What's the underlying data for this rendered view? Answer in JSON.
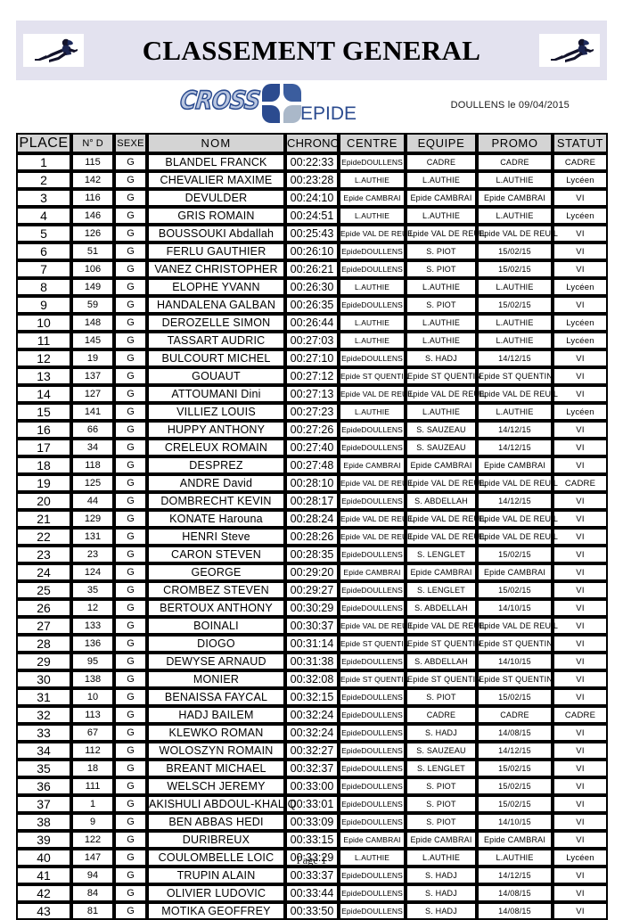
{
  "header": {
    "title": "CLASSEMENT GENERAL",
    "banner_color": "#e3e2ef",
    "runner_icon_left": "runner-icon",
    "runner_icon_right": "runner-icon"
  },
  "logo": {
    "cross_text": "CROSS",
    "epide_text": "EPIDE",
    "mark_icon": "epide-petals-icon",
    "accent_color": "#2b4b8f"
  },
  "event": {
    "location_date": "DOULLENS le 09/04/2015"
  },
  "table": {
    "columns": [
      "PLACE",
      "N° D",
      "SEXE",
      "NOM",
      "CHRONO",
      "CENTRE",
      "EQUIPE",
      "PROMO",
      "STATUT"
    ],
    "rows": [
      [
        "1",
        "115",
        "G",
        "BLANDEL FRANCK",
        "00:22:33",
        "EpideDOULLENS",
        "CADRE",
        "CADRE",
        "CADRE"
      ],
      [
        "2",
        "142",
        "G",
        "CHEVALIER MAXIME",
        "00:23:28",
        "L.AUTHIE",
        "L.AUTHIE",
        "L.AUTHIE",
        "Lycéen"
      ],
      [
        "3",
        "116",
        "G",
        "DEVULDER",
        "00:24:10",
        "Epide CAMBRAI",
        "Epide CAMBRAI",
        "Epide CAMBRAI",
        "VI"
      ],
      [
        "4",
        "146",
        "G",
        "GRIS ROMAIN",
        "00:24:51",
        "L.AUTHIE",
        "L.AUTHIE",
        "L.AUTHIE",
        "Lycéen"
      ],
      [
        "5",
        "126",
        "G",
        "BOUSSOUKI Abdallah",
        "00:25:43",
        "Epide VAL DE REUIL",
        "Epide VAL DE REUIL",
        "Epide VAL DE REUIL",
        "VI"
      ],
      [
        "6",
        "51",
        "G",
        "FERLU GAUTHIER",
        "00:26:10",
        "EpideDOULLENS",
        "S. PIOT",
        "15/02/15",
        "VI"
      ],
      [
        "7",
        "106",
        "G",
        "VANEZ CHRISTOPHER",
        "00:26:21",
        "EpideDOULLENS",
        "S. PIOT",
        "15/02/15",
        "VI"
      ],
      [
        "8",
        "149",
        "G",
        "ELOPHE YVANN",
        "00:26:30",
        "L.AUTHIE",
        "L.AUTHIE",
        "L.AUTHIE",
        "Lycéen"
      ],
      [
        "9",
        "59",
        "G",
        "HANDALENA GALBAN",
        "00:26:35",
        "EpideDOULLENS",
        "S. PIOT",
        "15/02/15",
        "VI"
      ],
      [
        "10",
        "148",
        "G",
        "DEROZELLE SIMON",
        "00:26:44",
        "L.AUTHIE",
        "L.AUTHIE",
        "L.AUTHIE",
        "Lycéen"
      ],
      [
        "11",
        "145",
        "G",
        "TASSART AUDRIC",
        "00:27:03",
        "L.AUTHIE",
        "L.AUTHIE",
        "L.AUTHIE",
        "Lycéen"
      ],
      [
        "12",
        "19",
        "G",
        "BULCOURT MICHEL",
        "00:27:10",
        "EpideDOULLENS",
        "S. HADJ",
        "14/12/15",
        "VI"
      ],
      [
        "13",
        "137",
        "G",
        "GOUAUT",
        "00:27:12",
        "Epide ST QUENTIN",
        "Epide ST QUENTIN",
        "Epide ST QUENTIN",
        "VI"
      ],
      [
        "14",
        "127",
        "G",
        "ATTOUMANI Dini",
        "00:27:13",
        "Epide VAL DE REUIL",
        "Epide VAL DE REUIL",
        "Epide VAL DE REUIL",
        "VI"
      ],
      [
        "15",
        "141",
        "G",
        "VILLIEZ LOUIS",
        "00:27:23",
        "L.AUTHIE",
        "L.AUTHIE",
        "L.AUTHIE",
        "Lycéen"
      ],
      [
        "16",
        "66",
        "G",
        "HUPPY ANTHONY",
        "00:27:26",
        "EpideDOULLENS",
        "S. SAUZEAU",
        "14/12/15",
        "VI"
      ],
      [
        "17",
        "34",
        "G",
        "CRELEUX ROMAIN",
        "00:27:40",
        "EpideDOULLENS",
        "S. SAUZEAU",
        "14/12/15",
        "VI"
      ],
      [
        "18",
        "118",
        "G",
        "DESPREZ",
        "00:27:48",
        "Epide CAMBRAI",
        "Epide CAMBRAI",
        "Epide CAMBRAI",
        "VI"
      ],
      [
        "19",
        "125",
        "G",
        "ANDRE David",
        "00:28:10",
        "Epide VAL DE REUIL",
        "Epide VAL DE REUIL",
        "Epide VAL DE REUIL",
        "CADRE"
      ],
      [
        "20",
        "44",
        "G",
        "DOMBRECHT KEVIN",
        "00:28:17",
        "EpideDOULLENS",
        "S. ABDELLAH",
        "14/12/15",
        "VI"
      ],
      [
        "21",
        "129",
        "G",
        "KONATE Harouna",
        "00:28:24",
        "Epide VAL DE REUIL",
        "Epide VAL DE REUIL",
        "Epide VAL DE REUIL",
        "VI"
      ],
      [
        "22",
        "131",
        "G",
        "HENRI Steve",
        "00:28:26",
        "Epide VAL DE REUIL",
        "Epide VAL DE REUIL",
        "Epide VAL DE REUIL",
        "VI"
      ],
      [
        "23",
        "23",
        "G",
        "CARON STEVEN",
        "00:28:35",
        "EpideDOULLENS",
        "S. LENGLET",
        "15/02/15",
        "VI"
      ],
      [
        "24",
        "124",
        "G",
        "GEORGE",
        "00:29:20",
        "Epide CAMBRAI",
        "Epide CAMBRAI",
        "Epide CAMBRAI",
        "VI"
      ],
      [
        "25",
        "35",
        "G",
        "CROMBEZ STEVEN",
        "00:29:27",
        "EpideDOULLENS",
        "S. LENGLET",
        "15/02/15",
        "VI"
      ],
      [
        "26",
        "12",
        "G",
        "BERTOUX ANTHONY",
        "00:30:29",
        "EpideDOULLENS",
        "S. ABDELLAH",
        "14/10/15",
        "VI"
      ],
      [
        "27",
        "133",
        "G",
        "BOINALI",
        "00:30:37",
        "Epide VAL DE REUIL",
        "Epide VAL DE REUIL",
        "Epide VAL DE REUIL",
        "VI"
      ],
      [
        "28",
        "136",
        "G",
        "DIOGO",
        "00:31:14",
        "Epide ST QUENTIN",
        "Epide ST QUENTIN",
        "Epide ST QUENTIN",
        "VI"
      ],
      [
        "29",
        "95",
        "G",
        "DEWYSE ARNAUD",
        "00:31:38",
        "EpideDOULLENS",
        "S. ABDELLAH",
        "14/10/15",
        "VI"
      ],
      [
        "30",
        "138",
        "G",
        "MONIER",
        "00:32:08",
        "Epide ST QUENTIN",
        "Epide ST QUENTIN",
        "Epide ST QUENTIN",
        "VI"
      ],
      [
        "31",
        "10",
        "G",
        "BENAISSA FAYCAL",
        "00:32:15",
        "EpideDOULLENS",
        "S. PIOT",
        "15/02/15",
        "VI"
      ],
      [
        "32",
        "113",
        "G",
        "HADJ BAILEM",
        "00:32:24",
        "EpideDOULLENS",
        "CADRE",
        "CADRE",
        "CADRE"
      ],
      [
        "33",
        "67",
        "G",
        "KLEWKO ROMAN",
        "00:32:24",
        "EpideDOULLENS",
        "S. HADJ",
        "14/08/15",
        "VI"
      ],
      [
        "34",
        "112",
        "G",
        "WOLOSZYN ROMAIN",
        "00:32:27",
        "EpideDOULLENS",
        "S. SAUZEAU",
        "14/12/15",
        "VI"
      ],
      [
        "35",
        "18",
        "G",
        "BREANT MICHAEL",
        "00:32:37",
        "EpideDOULLENS",
        "S. LENGLET",
        "15/02/15",
        "VI"
      ],
      [
        "36",
        "111",
        "G",
        "WELSCH JEREMY",
        "00:33:00",
        "EpideDOULLENS",
        "S. PIOT",
        "15/02/15",
        "VI"
      ],
      [
        "37",
        "1",
        "G",
        "AKISHULI ABDOUL-KHALIQ",
        "00:33:01",
        "EpideDOULLENS",
        "S. PIOT",
        "15/02/15",
        "VI"
      ],
      [
        "38",
        "9",
        "G",
        "BEN ABBAS HEDI",
        "00:33:09",
        "EpideDOULLENS",
        "S. PIOT",
        "14/10/15",
        "VI"
      ],
      [
        "39",
        "122",
        "G",
        "DURIBREUX",
        "00:33:15",
        "Epide CAMBRAI",
        "Epide CAMBRAI",
        "Epide CAMBRAI",
        "VI"
      ],
      [
        "40",
        "147",
        "G",
        "COULOMBELLE LOIC",
        "00:33:29",
        "L.AUTHIE",
        "L.AUTHIE",
        "L.AUTHIE",
        "Lycéen"
      ],
      [
        "41",
        "94",
        "G",
        "TRUPIN ALAIN",
        "00:33:37",
        "EpideDOULLENS",
        "S. HADJ",
        "14/12/15",
        "VI"
      ],
      [
        "42",
        "84",
        "G",
        "OLIVIER LUDOVIC",
        "00:33:44",
        "EpideDOULLENS",
        "S. HADJ",
        "14/08/15",
        "VI"
      ],
      [
        "43",
        "81",
        "G",
        "MOTIKA GEOFFREY",
        "00:33:50",
        "EpideDOULLENS",
        "S. HADJ",
        "14/08/15",
        "VI"
      ]
    ]
  },
  "footer": {
    "page_label": "Page 1"
  }
}
